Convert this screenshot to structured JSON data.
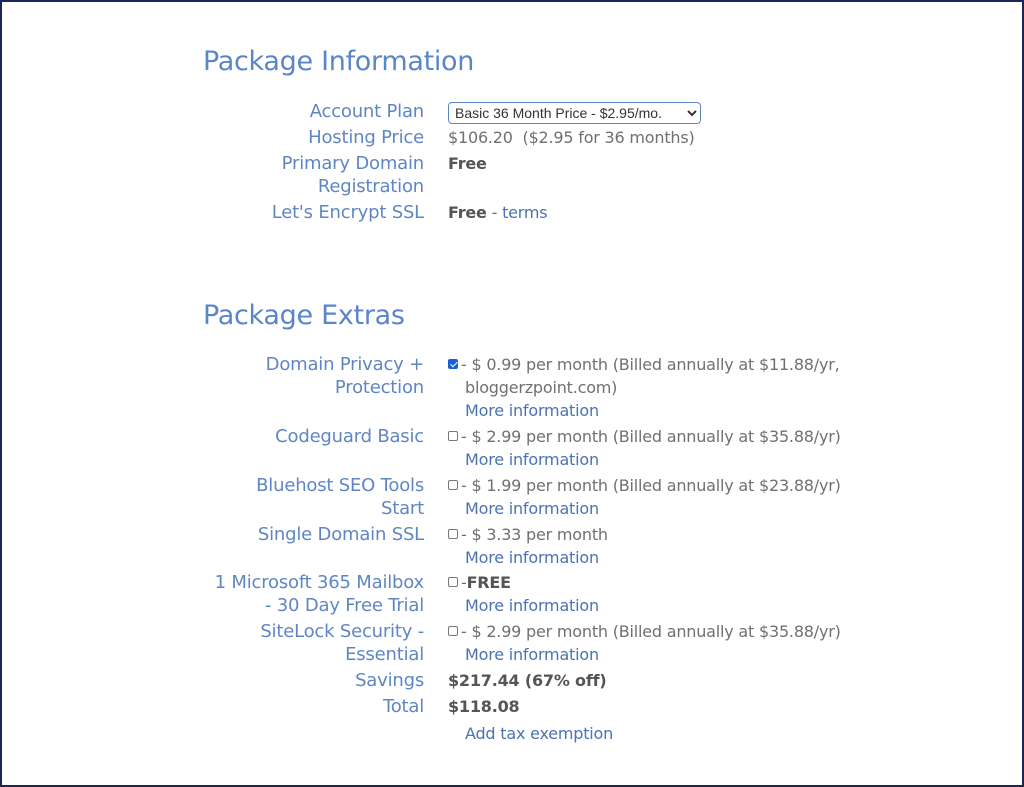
{
  "package_info": {
    "title": "Package Information",
    "account_plan": {
      "label": "Account Plan",
      "selected": "Basic 36 Month Price - $2.95/mo."
    },
    "hosting_price": {
      "label": "Hosting Price",
      "value": "$106.20  ($2.95 for 36 months)"
    },
    "primary_domain": {
      "label_line1": "Primary Domain",
      "label_line2": "Registration",
      "value": "Free"
    },
    "ssl": {
      "label": "Let's Encrypt SSL",
      "value": "Free",
      "separator": " - ",
      "link": "terms"
    }
  },
  "package_extras": {
    "title": "Package Extras",
    "items": [
      {
        "label_line1": "Domain Privacy +",
        "label_line2": "Protection",
        "checked": true,
        "price_line1": "- $ 0.99 per month (Billed annually at $11.88/yr,",
        "price_line2": "bloggerzpoint.com)",
        "more": "More information"
      },
      {
        "label_line1": "Codeguard Basic",
        "checked": false,
        "price_line1": "- $ 2.99 per month (Billed annually at $35.88/yr)",
        "more": "More information"
      },
      {
        "label_line1": "Bluehost SEO Tools",
        "label_line2": "Start",
        "checked": false,
        "price_line1": "- $ 1.99 per month (Billed annually at $23.88/yr)",
        "more": "More information"
      },
      {
        "label_line1": "Single Domain SSL",
        "checked": false,
        "price_line1": "- $ 3.33 per month",
        "more": "More information"
      },
      {
        "label_line1": "1 Microsoft 365 Mailbox",
        "label_line2": "- 30 Day Free Trial",
        "checked": false,
        "price_prefix": "-",
        "price_bold": "FREE",
        "more": "More information"
      },
      {
        "label_line1": "SiteLock Security -",
        "label_line2": "Essential",
        "checked": false,
        "price_line1": "- $ 2.99 per month (Billed annually at $35.88/yr)",
        "more": "More information"
      }
    ],
    "savings": {
      "label": "Savings",
      "value": "$217.44 (67% off)"
    },
    "total": {
      "label": "Total",
      "value": "$118.08"
    },
    "tax_exemption_link": "Add tax exemption"
  }
}
